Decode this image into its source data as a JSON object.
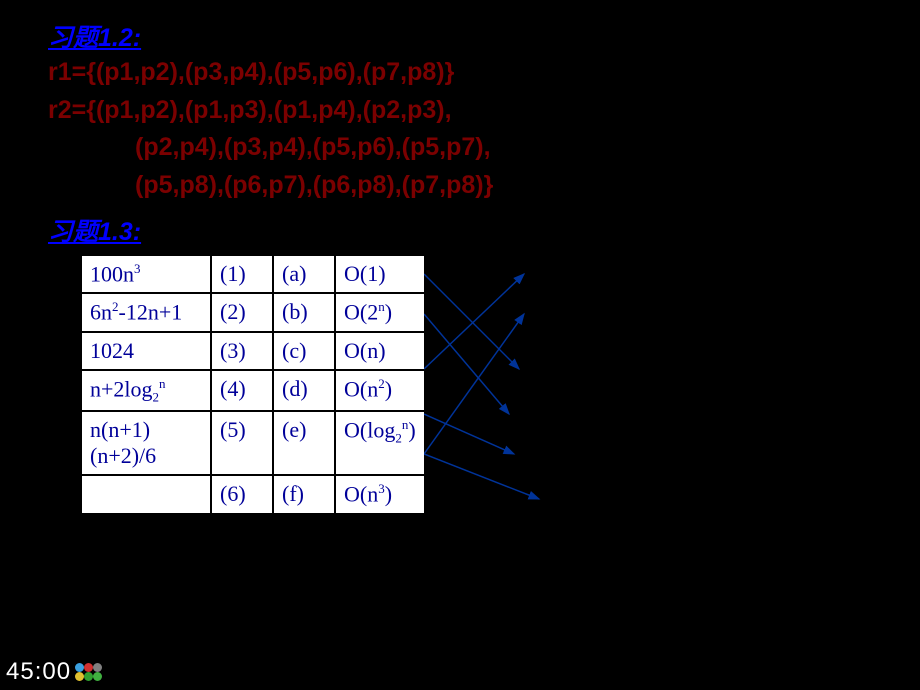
{
  "heading1": "习题1.2:",
  "r1": "r1={(p1,p2),(p3,p4),(p5,p6),(p7,p8)}",
  "r2_line1": "r2={(p1,p2),(p1,p3),(p1,p4),(p2,p3),",
  "r2_line2": "(p2,p4),(p3,p4),(p5,p6),(p5,p7),",
  "r2_line3": "(p5,p8),(p6,p7),(p6,p8),(p7,p8)}",
  "heading2": "习题1.3:",
  "table": {
    "rows": [
      {
        "c1_html": "100n<sup>3</sup>",
        "c2": "(1)",
        "c3": "(a)",
        "c4_html": "O(1)"
      },
      {
        "c1_html": "6n<sup>2</sup>-12n+1",
        "c2": "(2)",
        "c3": "(b)",
        "c4_html": "O(2<sup>n</sup>)"
      },
      {
        "c1_html": "1024",
        "c2": "(3)",
        "c3": "(c)",
        "c4_html": "O(n)"
      },
      {
        "c1_html": "n+2log<sub>2</sub><sup>n</sup>",
        "c2": "(4)",
        "c3": "(d)",
        "c4_html": "O(n<sup>2</sup>)"
      },
      {
        "c1_html": "n(n+1)(n+2)/6",
        "c2": "(5)",
        "c3": "(e)",
        "c4_html": "O(log<sub>2</sub><sup>n</sup>)"
      },
      {
        "c1_html": "",
        "c2": "(6)",
        "c3": "(f)",
        "c4_html": "O(n<sup>3</sup>)"
      }
    ]
  },
  "footer_time": "45:00"
}
